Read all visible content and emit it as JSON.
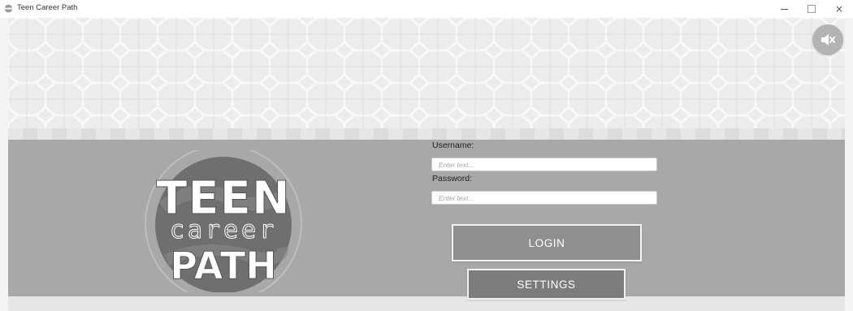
{
  "window": {
    "title": "Teen Career Path",
    "controls": {
      "minimize": "minimize",
      "maximize": "maximize",
      "close": "×"
    }
  },
  "header": {
    "mute_icon": "speaker-muted-icon"
  },
  "logo": {
    "line1": "TEEN",
    "line2": "career",
    "line3": "PATH"
  },
  "login_form": {
    "username_label": "Username:",
    "username_placeholder": "Enter text...",
    "username_value": "",
    "password_label": "Password:",
    "password_placeholder": "Enter text...",
    "password_value": "",
    "login_label": "LOGIN",
    "settings_label": "SETTINGS"
  },
  "colors": {
    "panel": "#a8a8a8",
    "button": "#8f8f8f",
    "pattern_background": "#ececec"
  }
}
